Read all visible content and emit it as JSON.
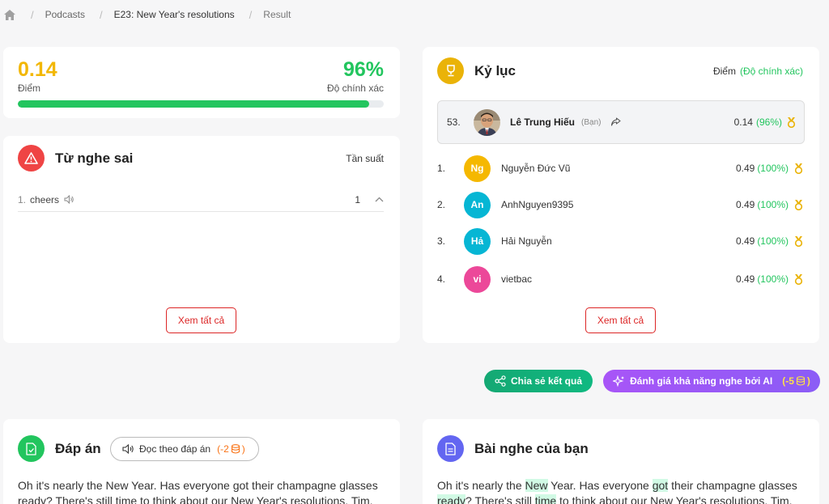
{
  "breadcrumb": {
    "items": [
      "Podcasts",
      "E23: New Year's resolutions",
      "Result"
    ]
  },
  "score": {
    "value": "0.14",
    "label": "Điểm",
    "accuracy": "96%",
    "accuracy_label": "Độ chính xác",
    "progress_percent": 96
  },
  "mistakes": {
    "title": "Từ nghe sai",
    "frequency_label": "Tần suất",
    "items": [
      {
        "num": "1.",
        "word": "cheers",
        "count": "1"
      }
    ],
    "view_all": "Xem tất cả"
  },
  "leaderboard": {
    "title": "Kỷ lục",
    "points_label": "Điểm",
    "accuracy_label": "(Độ chính xác)",
    "me": {
      "rank": "53.",
      "name": "Lê Trung Hiếu",
      "you_label": "(Bạn)",
      "score": "0.14",
      "pct": "(96%)"
    },
    "rows": [
      {
        "rank": "1.",
        "initials": "Ng",
        "name": "Nguyễn Đức Vũ",
        "score": "0.49",
        "pct": "(100%)",
        "color": "#f5b800"
      },
      {
        "rank": "2.",
        "initials": "An",
        "name": "AnhNguyen9395",
        "score": "0.49",
        "pct": "(100%)",
        "color": "#06b6d4"
      },
      {
        "rank": "3.",
        "initials": "Hả",
        "name": "Hải Nguyễn",
        "score": "0.49",
        "pct": "(100%)",
        "color": "#06b6d4"
      },
      {
        "rank": "4.",
        "initials": "vi",
        "name": "vietbac",
        "score": "0.49",
        "pct": "(100%)",
        "color": "#ec4899"
      }
    ],
    "view_all": "Xem tất cả"
  },
  "actions": {
    "share_label": "Chia sẻ kết quả",
    "ai_label": "Đánh giá khả năng nghe bởi AI",
    "ai_cost": "(-5"
  },
  "answer": {
    "title": "Đáp án",
    "read_label": "Đọc theo đáp án",
    "read_cost": "(-2",
    "text": "Oh it's nearly the New Year. Has everyone got their champagne glasses ready? There's still time to think about our New Year's resolutions. Tim,"
  },
  "yours": {
    "title": "Bài nghe của bạn",
    "segments": [
      {
        "t": "Oh it's nearly the ",
        "hl": false
      },
      {
        "t": "New",
        "hl": true
      },
      {
        "t": " Year. Has everyone ",
        "hl": false
      },
      {
        "t": "got",
        "hl": true
      },
      {
        "t": " their champagne glasses ",
        "hl": false
      },
      {
        "t": "ready",
        "hl": true
      },
      {
        "t": "? There's still ",
        "hl": false
      },
      {
        "t": "time",
        "hl": true
      },
      {
        "t": " to think about our New Year's resolutions. Tim,",
        "hl": false
      }
    ]
  },
  "colors": {
    "yellow": "#f2b705",
    "green": "#22c55e",
    "red": "#ef4444",
    "purple": "#8b5cf6",
    "indigo": "#6366f1"
  }
}
